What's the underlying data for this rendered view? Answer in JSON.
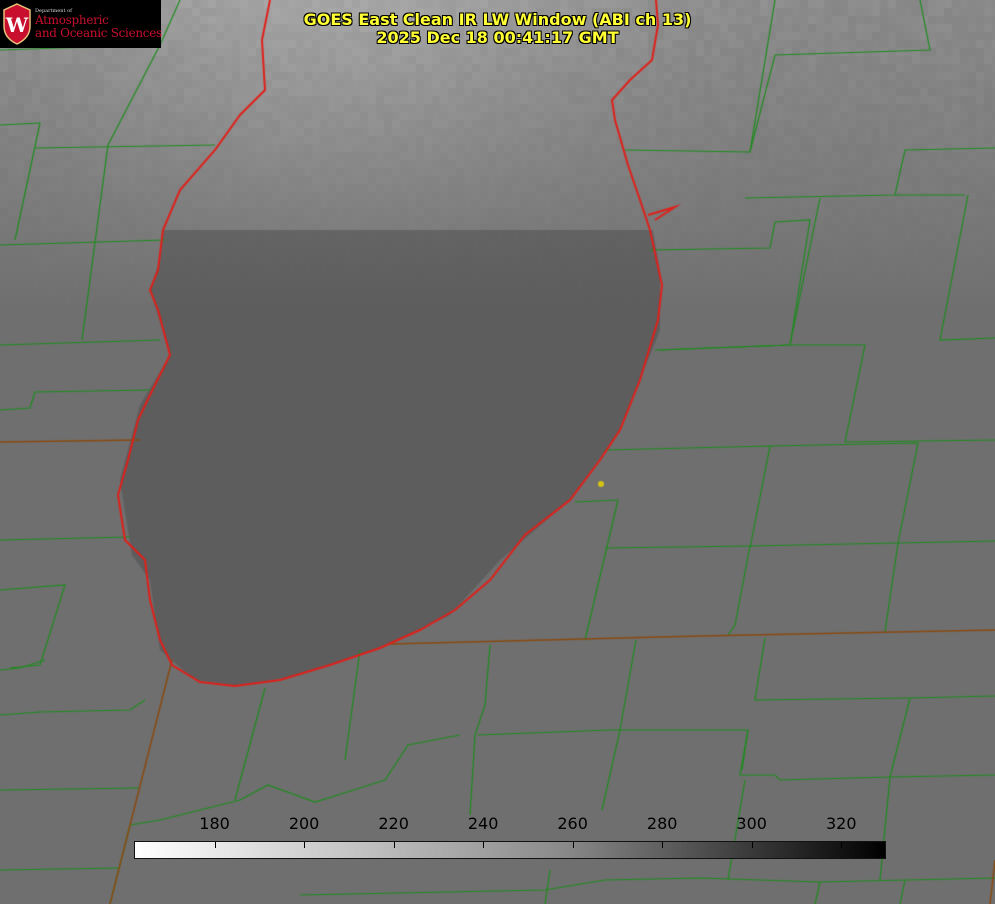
{
  "logo": {
    "department": "Department of",
    "line1": "Atmospheric",
    "line2": "and Oceanic Sciences",
    "seal_letter": "W",
    "colors": {
      "background": "#000000",
      "text": "#c8102e",
      "seal": "#c8102e"
    }
  },
  "title": {
    "line1": "GOES East Clean IR LW Window (ABI ch 13)",
    "line2": "2025 Dec 18 00:41:17 GMT",
    "color": "#ffff33"
  },
  "colorbar": {
    "ticks": [
      "180",
      "200",
      "220",
      "240",
      "260",
      "280",
      "300",
      "320"
    ],
    "min": 162,
    "max": 330,
    "colormap": "white-to-black grayscale"
  },
  "map": {
    "boundary_color": "#1e8c1e",
    "state_line_color": "#8a4a10",
    "shoreline_color": "#e0201a",
    "marker_color": "#d4c414",
    "background_gray": "#6f6f6f"
  }
}
